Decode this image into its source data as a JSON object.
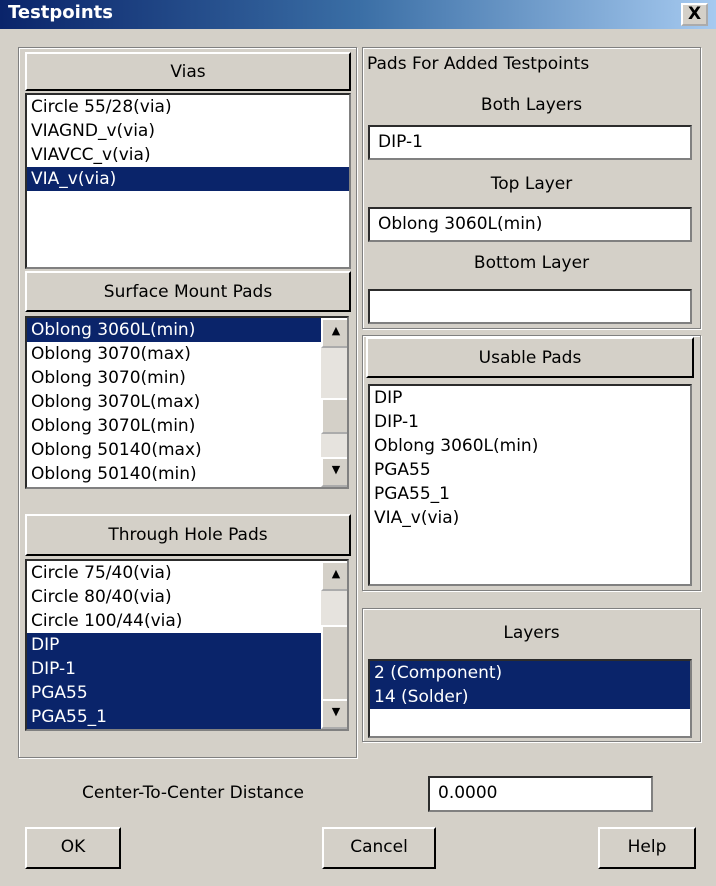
{
  "window": {
    "title": "Testpoints",
    "close_label": "X"
  },
  "vias": {
    "header": "Vias",
    "items": [
      "Circle 55/28(via)",
      "VIAGND_v(via)",
      "VIAVCC_v(via)",
      "VIA_v(via)"
    ],
    "selected": [
      3
    ]
  },
  "smd": {
    "header": "Surface Mount Pads",
    "items": [
      "Oblong 3060L(min)",
      "Oblong 3070(max)",
      "Oblong 3070(min)",
      "Oblong 3070L(max)",
      "Oblong 3070L(min)",
      "Oblong 50140(max)",
      "Oblong 50140(min)"
    ],
    "selected": [
      0
    ]
  },
  "through": {
    "header": "Through Hole Pads",
    "items": [
      "Circle 75/40(via)",
      "Circle 80/40(via)",
      "Circle 100/44(via)",
      "DIP",
      "DIP-1",
      "PGA55",
      "PGA55_1"
    ],
    "selected": [
      3,
      4,
      5,
      6
    ]
  },
  "pads_added": {
    "title": "Pads For Added Testpoints",
    "both_label": "Both Layers",
    "both_value": "DIP-1",
    "top_label": "Top Layer",
    "top_value": "Oblong 3060L(min)",
    "bottom_label": "Bottom Layer",
    "bottom_value": ""
  },
  "usable": {
    "header": "Usable Pads",
    "items": [
      "DIP",
      "DIP-1",
      "Oblong 3060L(min)",
      "PGA55",
      "PGA55_1",
      "VIA_v(via)"
    ]
  },
  "layers": {
    "header": "Layers",
    "items": [
      "2  (Component)",
      "14 (Solder)"
    ],
    "selected": [
      0,
      1
    ]
  },
  "distance": {
    "label": "Center-To-Center Distance",
    "value": "0.0000"
  },
  "buttons": {
    "ok": "OK",
    "cancel": "Cancel",
    "help": "Help"
  }
}
